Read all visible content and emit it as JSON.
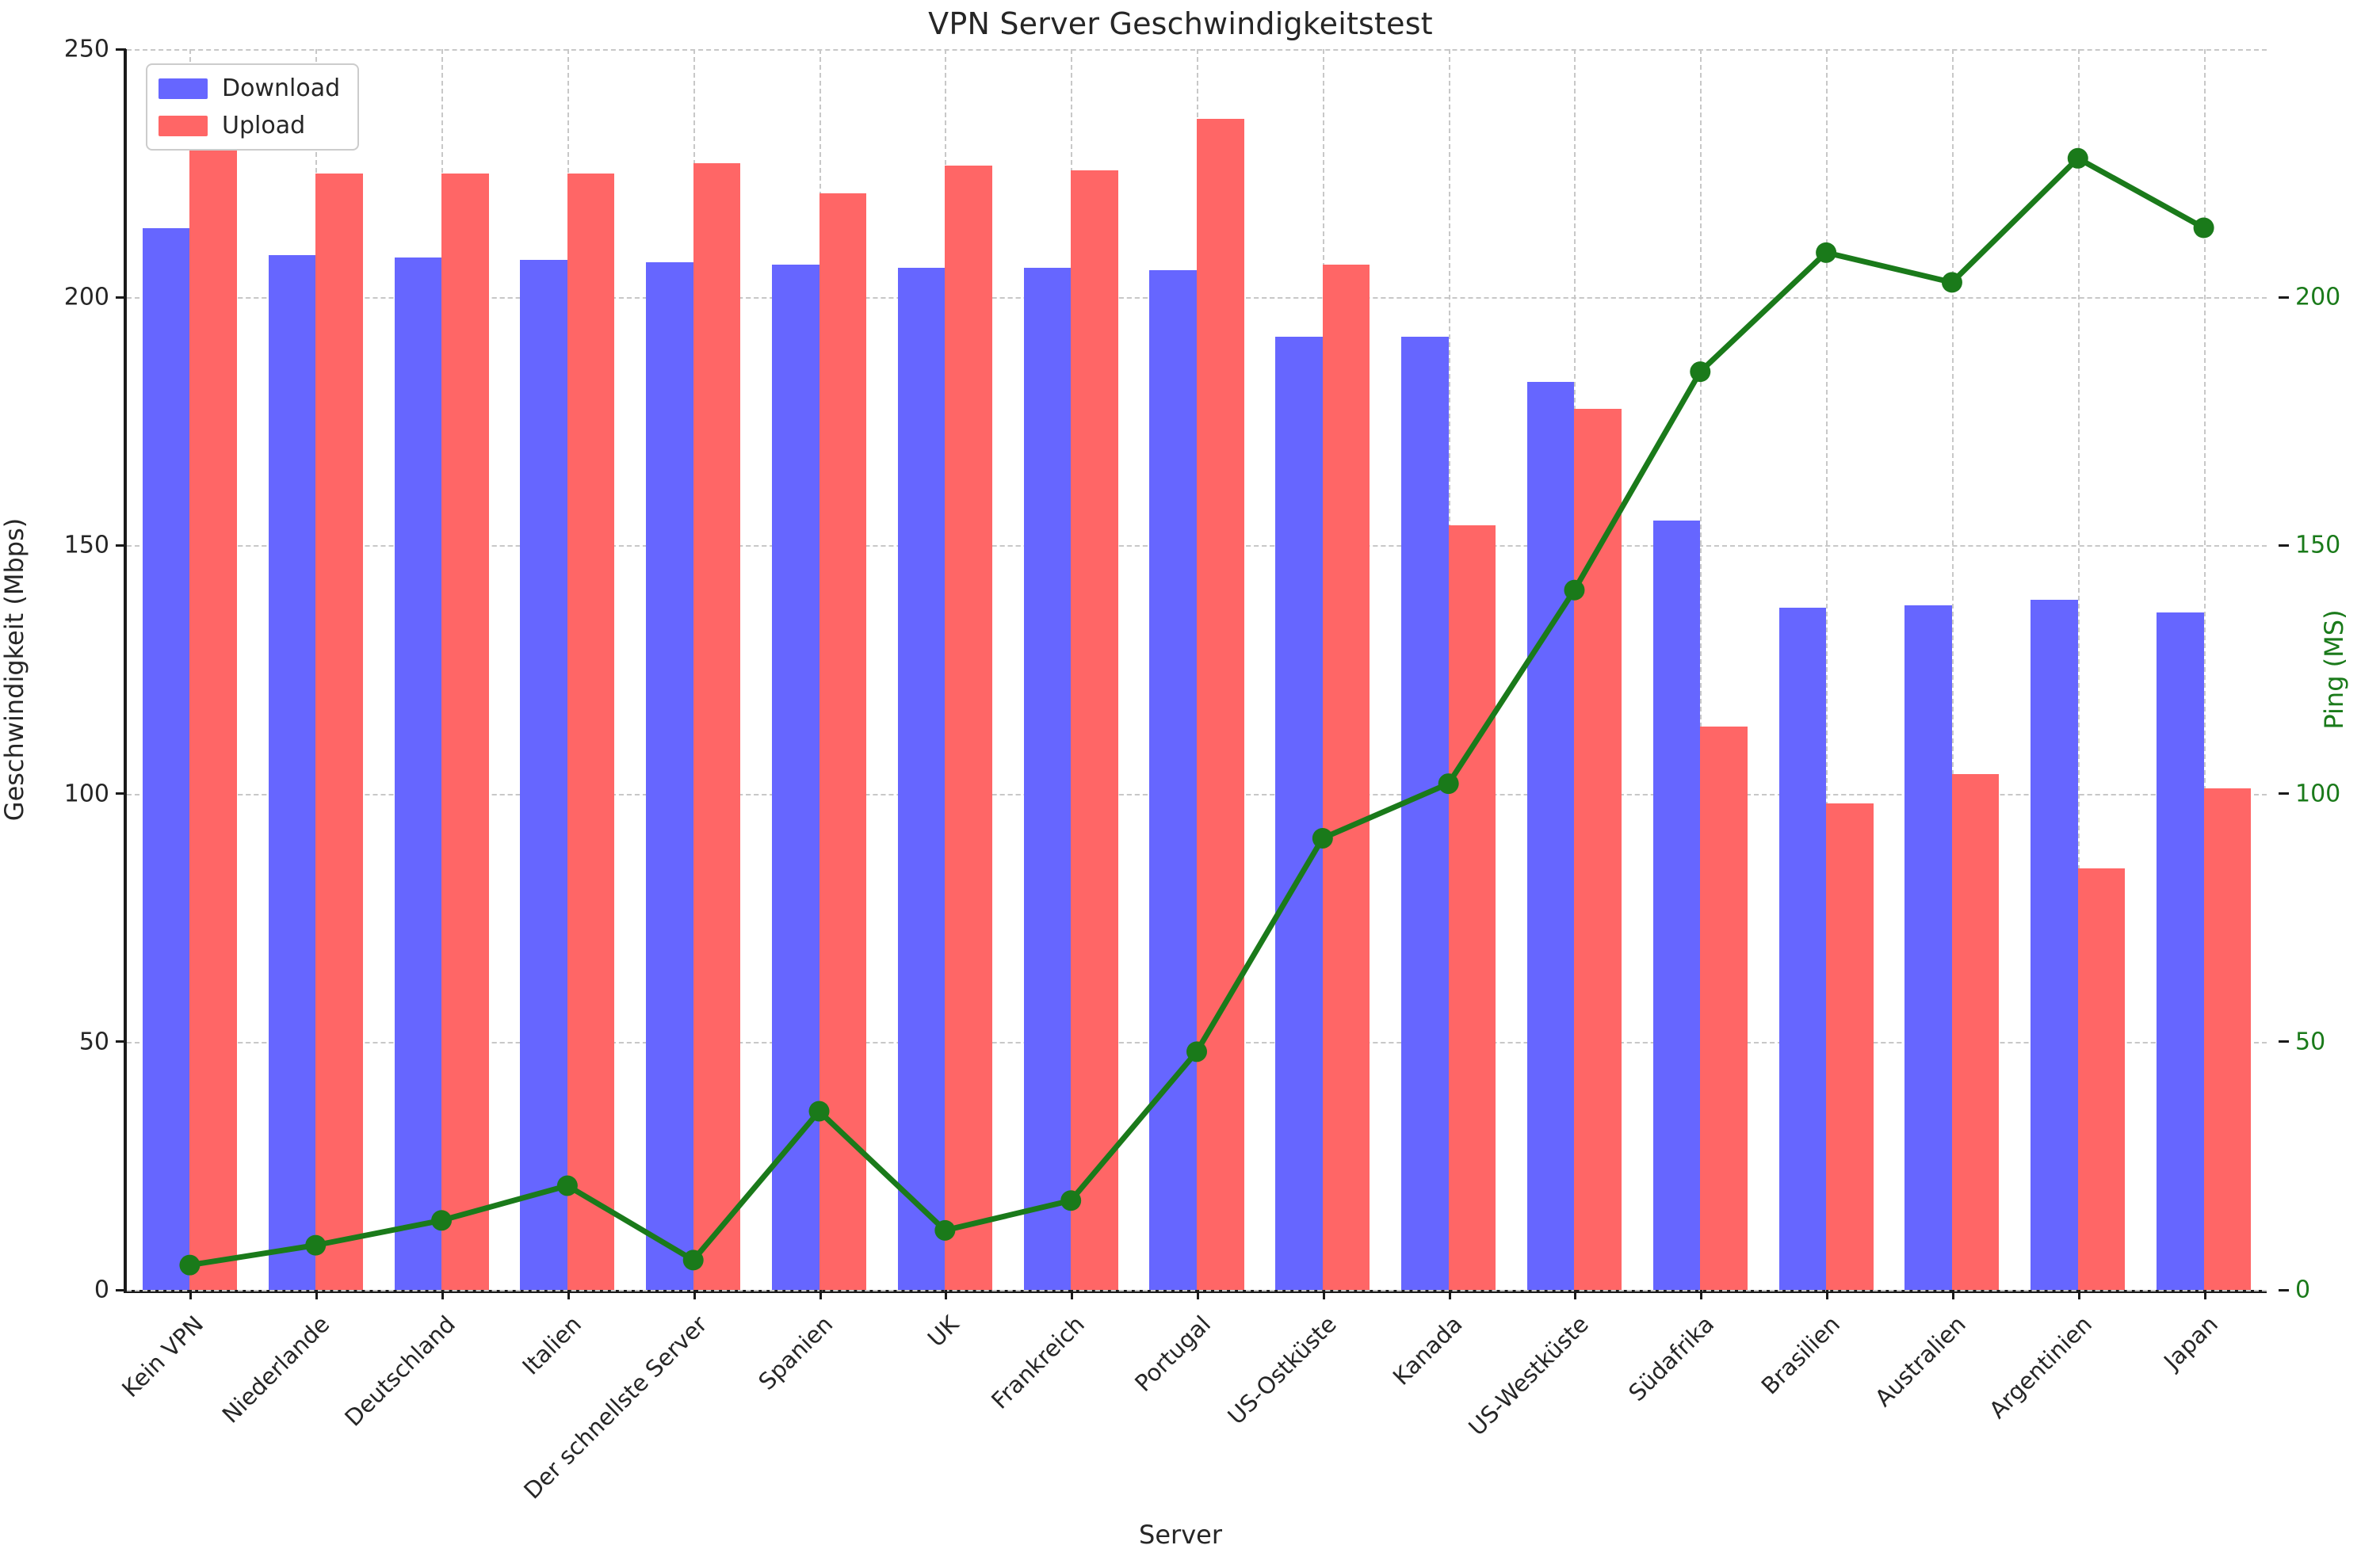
{
  "chart_data": {
    "type": "bar",
    "title": "VPN Server Geschwindigkeitstest",
    "xlabel": "Server",
    "ylabel": "Geschwindigkeit (Mbps)",
    "y2label": "Ping (MS)",
    "ylim": [
      0,
      250
    ],
    "y2lim": [
      0,
      250
    ],
    "yticks": [
      0,
      50,
      100,
      150,
      200,
      250
    ],
    "y2ticks": [
      0,
      50,
      100,
      150,
      200
    ],
    "grid": true,
    "legend_position": "upper left",
    "colors": {
      "download": "#6666ff",
      "upload": "#ff6666",
      "ping": "#1a7a1a"
    },
    "categories": [
      "Kein VPN",
      "Niederlande",
      "Deutschland",
      "Italien",
      "Der schnellste Server",
      "Spanien",
      "UK",
      "Frankreich",
      "Portugal",
      "US-Ostküste",
      "Kanada",
      "US-Westküste",
      "Südafrika",
      "Brasilien",
      "Australien",
      "Argentinien",
      "Japan"
    ],
    "series": [
      {
        "name": "Download",
        "type": "bar",
        "axis": "left",
        "color": "#6666ff",
        "values": [
          214,
          208.5,
          208,
          207.5,
          207,
          206.5,
          206,
          206,
          205.5,
          192,
          192,
          183,
          155,
          137.5,
          138,
          139,
          136.5
        ]
      },
      {
        "name": "Upload",
        "type": "bar",
        "axis": "left",
        "color": "#ff6666",
        "values": [
          238,
          225,
          225,
          225,
          227,
          221,
          226.5,
          225.5,
          236,
          206.5,
          154,
          177.5,
          113.5,
          98,
          104,
          85,
          101
        ]
      },
      {
        "name": "Ping (MS)",
        "type": "line",
        "axis": "right",
        "color": "#1a7a1a",
        "values": [
          5,
          9,
          14,
          21,
          6,
          36,
          12,
          18,
          48,
          91,
          102,
          141,
          185,
          209,
          203,
          228,
          214
        ]
      }
    ]
  },
  "legend": {
    "items": [
      {
        "label": "Download",
        "color": "#6666ff"
      },
      {
        "label": "Upload",
        "color": "#ff6666"
      }
    ]
  }
}
